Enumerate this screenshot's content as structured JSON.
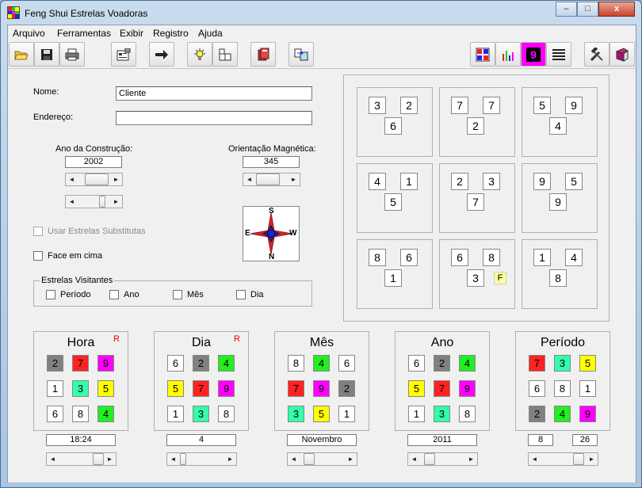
{
  "window": {
    "title": "Feng Shui Estrelas Voadoras",
    "min_label": "–",
    "max_label": "□",
    "close_label": "x"
  },
  "menu": [
    "Arquivo",
    "Ferramentas",
    "Exibir",
    "Registro",
    "Ajuda"
  ],
  "toolbar": {
    "left_icons": [
      "open-folder-icon",
      "save-icon",
      "print-icon",
      "properties-icon",
      "arrow-icon",
      "lightbulb-icon",
      "layout-icon",
      "book-icon",
      "export-icon"
    ],
    "right_icons": [
      "grid-icon",
      "chart-icon",
      "nine-icon",
      "lines-icon",
      "tools-icon",
      "help-book-icon"
    ],
    "nine_label": "9"
  },
  "form": {
    "nome_label": "Nome:",
    "nome_value": "Cliente",
    "endereco_label": "Endereço:",
    "endereco_value": "",
    "ano_label": "Ano da Construção:",
    "ano_value": "2002",
    "orientacao_label": "Orientação Magnética:",
    "orientacao_value": "345",
    "substitutas_label": "Usar Estrelas Substitutas",
    "face_label": "Face em cima",
    "visitantes_label": "Estrelas Visitantes",
    "visitantes": [
      "Período",
      "Ano",
      "Mês",
      "Dia"
    ]
  },
  "compass": {
    "n": "N",
    "s": "S",
    "e": "E",
    "w": "W"
  },
  "chart": {
    "palaces": [
      {
        "tl": "3",
        "tr": "2",
        "c": "6"
      },
      {
        "tl": "7",
        "tr": "7",
        "c": "2"
      },
      {
        "tl": "5",
        "tr": "9",
        "c": "4"
      },
      {
        "tl": "4",
        "tr": "1",
        "c": "5"
      },
      {
        "tl": "2",
        "tr": "3",
        "c": "7"
      },
      {
        "tl": "9",
        "tr": "5",
        "c": "9"
      },
      {
        "tl": "8",
        "tr": "6",
        "c": "1"
      },
      {
        "tl": "6",
        "tr": "8",
        "c": "3"
      },
      {
        "tl": "1",
        "tr": "4",
        "c": "8"
      }
    ],
    "facing_marker": "F"
  },
  "colors": {
    "1": "#ffffff",
    "2": "#808080",
    "3": "#33ffaa",
    "4": "#22ee22",
    "5": "#ffff00",
    "6": "#ffffff",
    "7": "#ff2222",
    "8": "#ffffff",
    "9": "#ff00ff"
  },
  "visitors": [
    {
      "title": "Hora",
      "mark": "R",
      "grid": [
        "2",
        "7",
        "9",
        "1",
        "3",
        "5",
        "6",
        "8",
        "4"
      ],
      "value": "18:24"
    },
    {
      "title": "Dia",
      "mark": "R",
      "grid": [
        "6",
        "2",
        "4",
        "5",
        "7",
        "9",
        "1",
        "3",
        "8"
      ],
      "value": "4"
    },
    {
      "title": "Mês",
      "mark": "",
      "grid": [
        "8",
        "4",
        "6",
        "7",
        "9",
        "2",
        "3",
        "5",
        "1"
      ],
      "value": "Novembro"
    },
    {
      "title": "Ano",
      "mark": "",
      "grid": [
        "6",
        "2",
        "4",
        "5",
        "7",
        "9",
        "1",
        "3",
        "8"
      ],
      "value": "2011"
    },
    {
      "title": "Período",
      "mark": "",
      "grid": [
        "7",
        "3",
        "5",
        "6",
        "8",
        "1",
        "2",
        "4",
        "9"
      ],
      "value": "8",
      "value2": "26"
    }
  ]
}
